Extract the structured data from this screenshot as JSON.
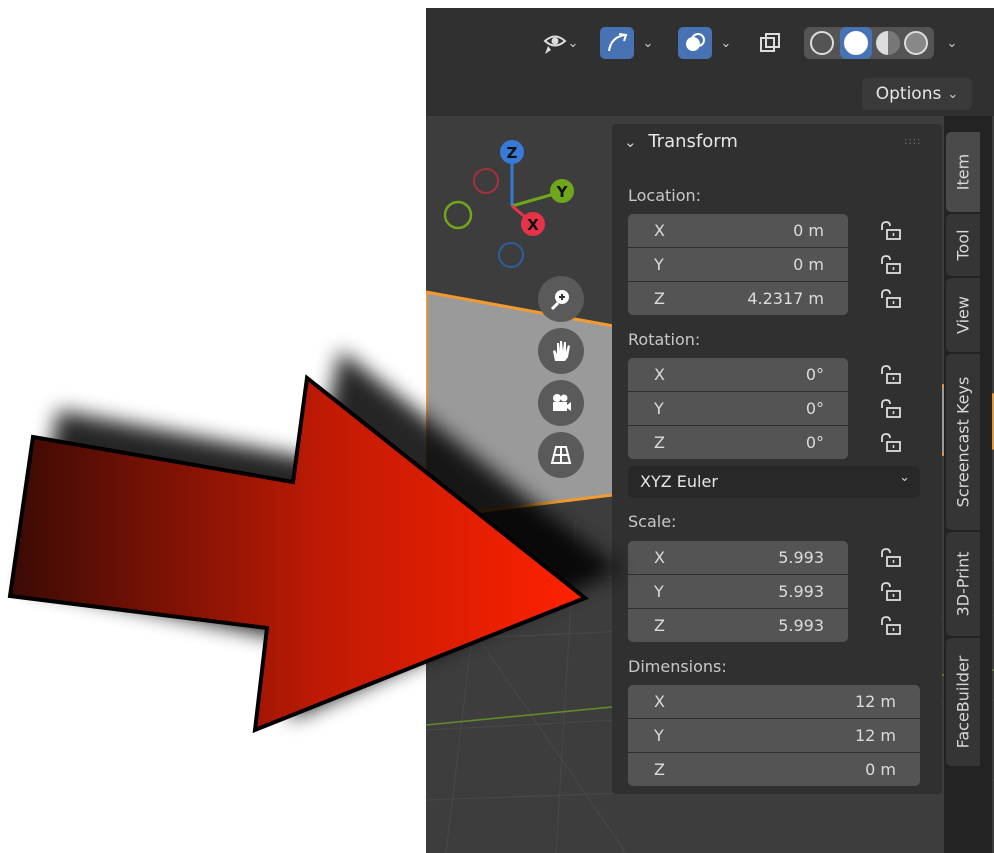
{
  "header": {
    "options_label": "Options"
  },
  "transform": {
    "title": "Transform",
    "location": {
      "label": "Location:",
      "fields": [
        {
          "axis": "X",
          "value": "0 m"
        },
        {
          "axis": "Y",
          "value": "0 m"
        },
        {
          "axis": "Z",
          "value": "4.2317 m"
        }
      ]
    },
    "rotation": {
      "label": "Rotation:",
      "fields": [
        {
          "axis": "X",
          "value": "0°"
        },
        {
          "axis": "Y",
          "value": "0°"
        },
        {
          "axis": "Z",
          "value": "0°"
        }
      ],
      "mode": "XYZ Euler"
    },
    "scale": {
      "label": "Scale:",
      "fields": [
        {
          "axis": "X",
          "value": "5.993"
        },
        {
          "axis": "Y",
          "value": "5.993"
        },
        {
          "axis": "Z",
          "value": "5.993"
        }
      ]
    },
    "dimensions": {
      "label": "Dimensions:",
      "fields": [
        {
          "axis": "X",
          "value": "12 m"
        },
        {
          "axis": "Y",
          "value": "12 m"
        },
        {
          "axis": "Z",
          "value": "0 m"
        }
      ]
    }
  },
  "tabs": [
    "Item",
    "Tool",
    "View",
    "Screencast Keys",
    "3D-Print",
    "FaceBuilder"
  ],
  "gizmo": {
    "x": "X",
    "y": "Y",
    "z": "Z"
  },
  "icons": {
    "visibility": "eye-icon",
    "gizmo": "gizmo-toggle-icon",
    "overlay": "overlay-icon",
    "xray": "xray-icon",
    "zoom": "zoom-icon",
    "pan": "hand-icon",
    "camera": "camera-icon",
    "grid": "grid-icon",
    "lock": "lock-icon"
  },
  "colors": {
    "accent_blue": "#4772b3",
    "arrow_start": "#3a0a05",
    "arrow_end": "#ff2200",
    "axis_x": "#e6334a",
    "axis_y": "#6fa61c",
    "axis_z": "#3779d6",
    "object_edge": "#f29a2e"
  }
}
